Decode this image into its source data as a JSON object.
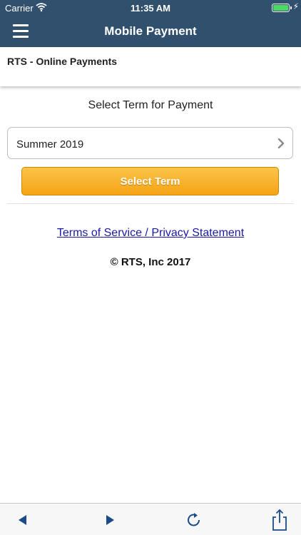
{
  "status_bar": {
    "carrier": "Carrier",
    "time": "11:35 AM",
    "battery_level": 1.0,
    "battery_color": "#4cd964"
  },
  "nav": {
    "title": "Mobile Payment",
    "menu_icon": "hamburger-icon",
    "background": "#30506e"
  },
  "sub_header": {
    "label": "RTS - Online Payments"
  },
  "main": {
    "section_title": "Select Term for Payment",
    "term_select": {
      "value": "Summer 2019",
      "icon": "chevron-right-icon"
    },
    "select_button": {
      "label": "Select Term",
      "color": "#f6a315"
    },
    "tos_link": "Terms of Service / Privacy Statement",
    "copyright": "© RTS, Inc 2017"
  },
  "toolbar": {
    "icons": [
      "back-arrow-icon",
      "forward-arrow-icon",
      "reload-icon",
      "share-icon"
    ],
    "tint": "#1a4a8a"
  }
}
